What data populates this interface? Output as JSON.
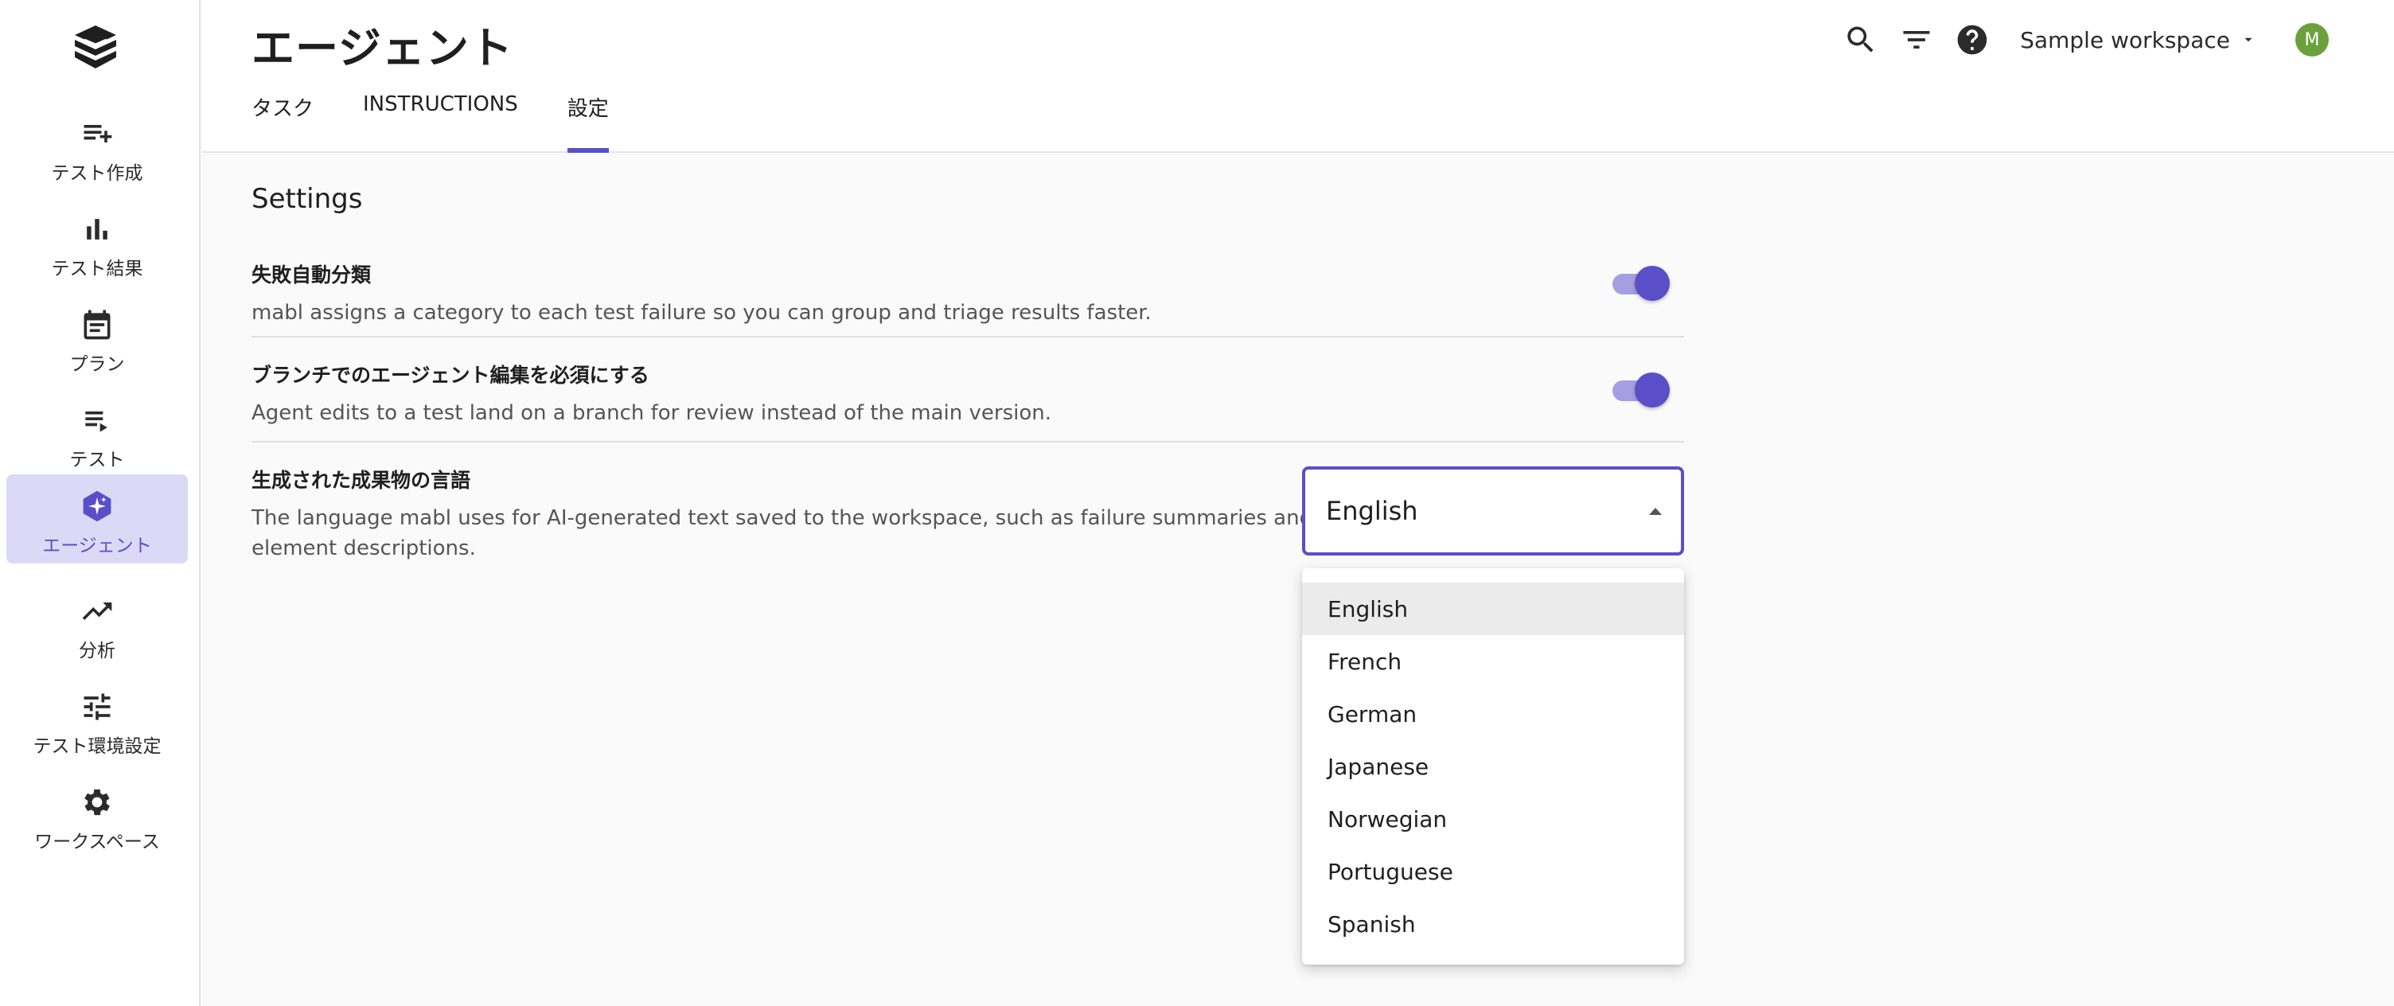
{
  "sidebar": {
    "items": [
      {
        "label": "テスト作成",
        "icon": "playlist-add-icon"
      },
      {
        "label": "テスト結果",
        "icon": "bar-chart-icon"
      },
      {
        "label": "プラン",
        "icon": "calendar-icon"
      },
      {
        "label": "テスト",
        "icon": "playlist-play-icon"
      },
      {
        "label": "エージェント",
        "icon": "sparkle-hexagon-icon"
      },
      {
        "label": "分析",
        "icon": "trending-up-icon"
      },
      {
        "label": "テスト環境設定",
        "icon": "tune-icon"
      },
      {
        "label": "ワークスペース",
        "icon": "gear-icon"
      }
    ]
  },
  "header": {
    "title": "エージェント",
    "tabs": [
      {
        "label": "タスク"
      },
      {
        "label": "INSTRUCTIONS"
      },
      {
        "label": "設定"
      }
    ],
    "workspace": "Sample workspace",
    "avatar_initial": "M"
  },
  "main": {
    "section_title": "Settings",
    "settings": [
      {
        "title": "失敗自動分類",
        "description": "mabl assigns a category to each test failure so you can group and triage results faster."
      },
      {
        "title": "ブランチでのエージェント編集を必須にする",
        "description": "Agent edits to a test land on a branch for review instead of the main version."
      },
      {
        "title": "生成された成果物の言語",
        "description_line1": "The language mabl uses for AI-generated text saved to the workspace, such as failure summaries and",
        "description_line2": "element descriptions.",
        "selected_value": "English"
      }
    ],
    "language_options": [
      "English",
      "French",
      "German",
      "Japanese",
      "Norwegian",
      "Portuguese",
      "Spanish"
    ]
  },
  "colors": {
    "accent": "#5a4fc8",
    "active_nav_bg": "#dcd9f7",
    "avatar": "#6ba13c"
  }
}
